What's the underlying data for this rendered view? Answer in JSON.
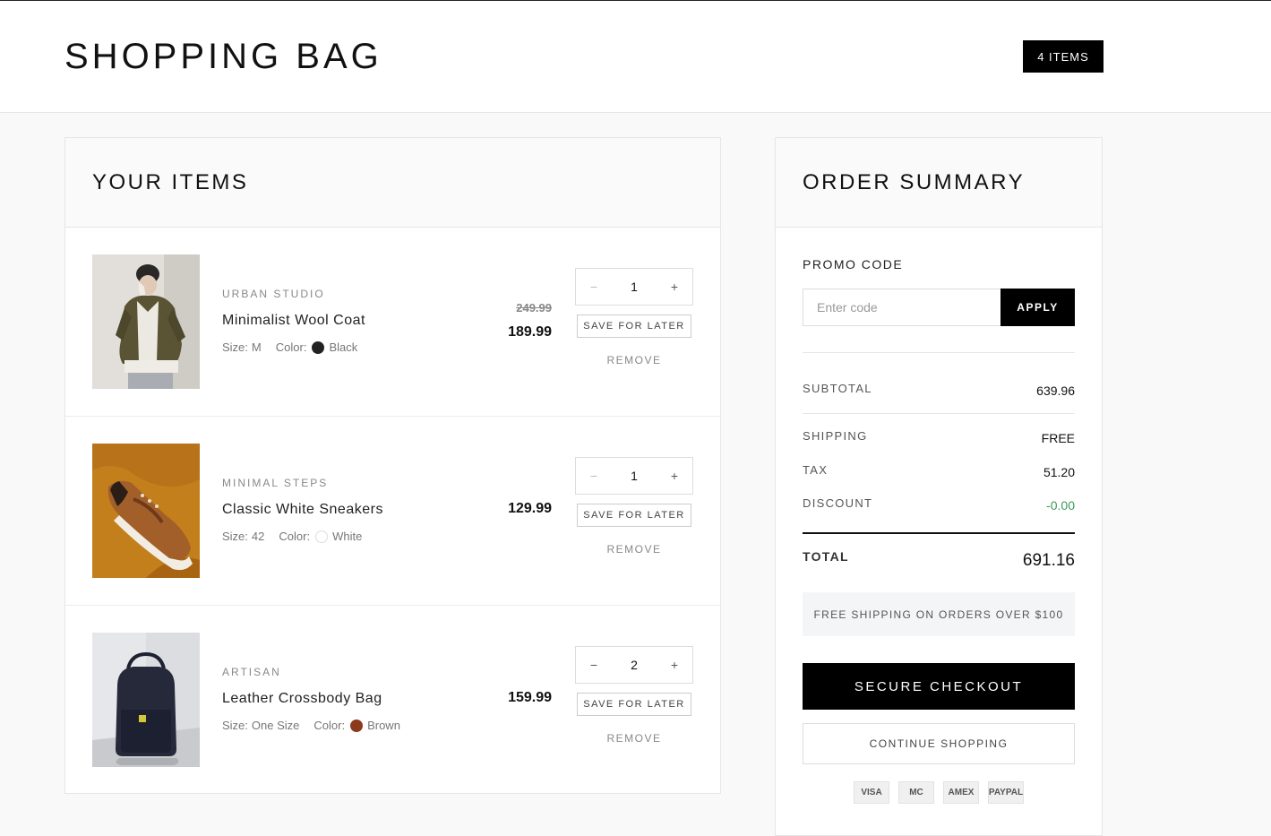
{
  "header": {
    "title": "SHOPPING BAG",
    "item_count": "4 ITEMS"
  },
  "items_panel": {
    "title": "YOUR ITEMS",
    "items": [
      {
        "brand": "URBAN STUDIO",
        "name": "Minimalist Wool Coat",
        "size_label": "Size:",
        "size": "M",
        "color_label": "Color:",
        "color": "Black",
        "swatch": "#222222",
        "old_price": "249.99",
        "price": "189.99",
        "quantity": "1",
        "decrement": "−",
        "increment": "+",
        "save_label": "SAVE FOR LATER",
        "remove_label": "REMOVE"
      },
      {
        "brand": "MINIMAL STEPS",
        "name": "Classic White Sneakers",
        "size_label": "Size:",
        "size": "42",
        "color_label": "Color:",
        "color": "White",
        "swatch": "#ffffff",
        "price": "129.99",
        "quantity": "1",
        "decrement": "−",
        "increment": "+",
        "save_label": "SAVE FOR LATER",
        "remove_label": "REMOVE"
      },
      {
        "brand": "ARTISAN",
        "name": "Leather Crossbody Bag",
        "size_label": "Size:",
        "size": "One Size",
        "color_label": "Color:",
        "color": "Brown",
        "swatch": "#8b3a1a",
        "price": "159.99",
        "quantity": "2",
        "decrement": "−",
        "increment": "+",
        "save_label": "SAVE FOR LATER",
        "remove_label": "REMOVE"
      }
    ]
  },
  "summary": {
    "title": "ORDER SUMMARY",
    "promo_label": "PROMO CODE",
    "promo_placeholder": "Enter code",
    "apply_label": "APPLY",
    "subtotal_label": "SUBTOTAL",
    "subtotal": "639.96",
    "shipping_label": "SHIPPING",
    "shipping": "FREE",
    "tax_label": "TAX",
    "tax": "51.20",
    "discount_label": "DISCOUNT",
    "discount": "-0.00",
    "total_label": "TOTAL",
    "total": "691.16",
    "free_shipping_note": "FREE SHIPPING ON ORDERS OVER $100",
    "checkout_label": "SECURE CHECKOUT",
    "continue_label": "CONTINUE SHOPPING",
    "payment_methods": [
      "VISA",
      "MC",
      "AMEX",
      "PAYPAL"
    ]
  },
  "colors": {
    "accent": "#000000",
    "discount_green": "#3a9a5a"
  }
}
